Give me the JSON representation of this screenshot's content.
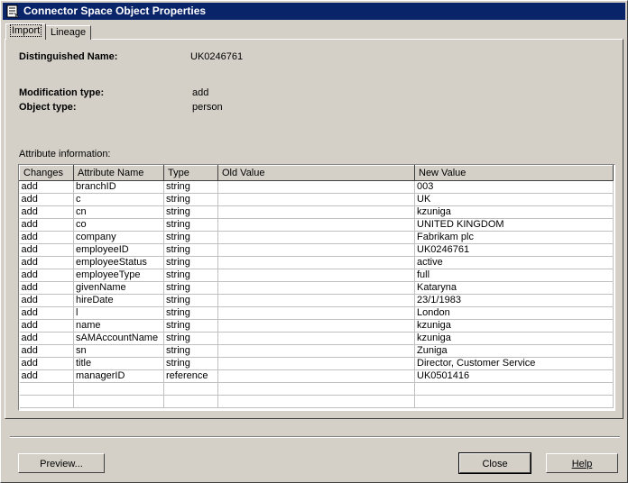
{
  "window": {
    "title": "Connector Space Object Properties"
  },
  "tabs": [
    {
      "label": "Import",
      "selected": true
    },
    {
      "label": "Lineage",
      "selected": false
    }
  ],
  "properties": {
    "dn_label": "Distinguished Name:",
    "dn_value": "UK0246761",
    "modtype_label": "Modification type:",
    "modtype_value": "add",
    "objtype_label": "Object type:",
    "objtype_value": "person",
    "attr_info_label": "Attribute information:"
  },
  "grid": {
    "columns": [
      "Changes",
      "Attribute Name",
      "Type",
      "Old Value",
      "New Value"
    ],
    "rows": [
      [
        "add",
        "branchID",
        "string",
        "",
        "003"
      ],
      [
        "add",
        "c",
        "string",
        "",
        "UK"
      ],
      [
        "add",
        "cn",
        "string",
        "",
        "kzuniga"
      ],
      [
        "add",
        "co",
        "string",
        "",
        "UNITED KINGDOM"
      ],
      [
        "add",
        "company",
        "string",
        "",
        "Fabrikam plc"
      ],
      [
        "add",
        "employeeID",
        "string",
        "",
        "UK0246761"
      ],
      [
        "add",
        "employeeStatus",
        "string",
        "",
        "active"
      ],
      [
        "add",
        "employeeType",
        "string",
        "",
        "full"
      ],
      [
        "add",
        "givenName",
        "string",
        "",
        "Kataryna"
      ],
      [
        "add",
        "hireDate",
        "string",
        "",
        "23/1/1983"
      ],
      [
        "add",
        "l",
        "string",
        "",
        "London"
      ],
      [
        "add",
        "name",
        "string",
        "",
        "kzuniga"
      ],
      [
        "add",
        "sAMAccountName",
        "string",
        "",
        "kzuniga"
      ],
      [
        "add",
        "sn",
        "string",
        "",
        "Zuniga"
      ],
      [
        "add",
        "title",
        "string",
        "",
        "Director, Customer Service"
      ],
      [
        "add",
        "managerID",
        "reference",
        "",
        "UK0501416"
      ]
    ]
  },
  "buttons": {
    "preview": "Preview...",
    "close": "Close",
    "help": "Help"
  },
  "icons": {
    "title_icon": "properties-icon"
  }
}
